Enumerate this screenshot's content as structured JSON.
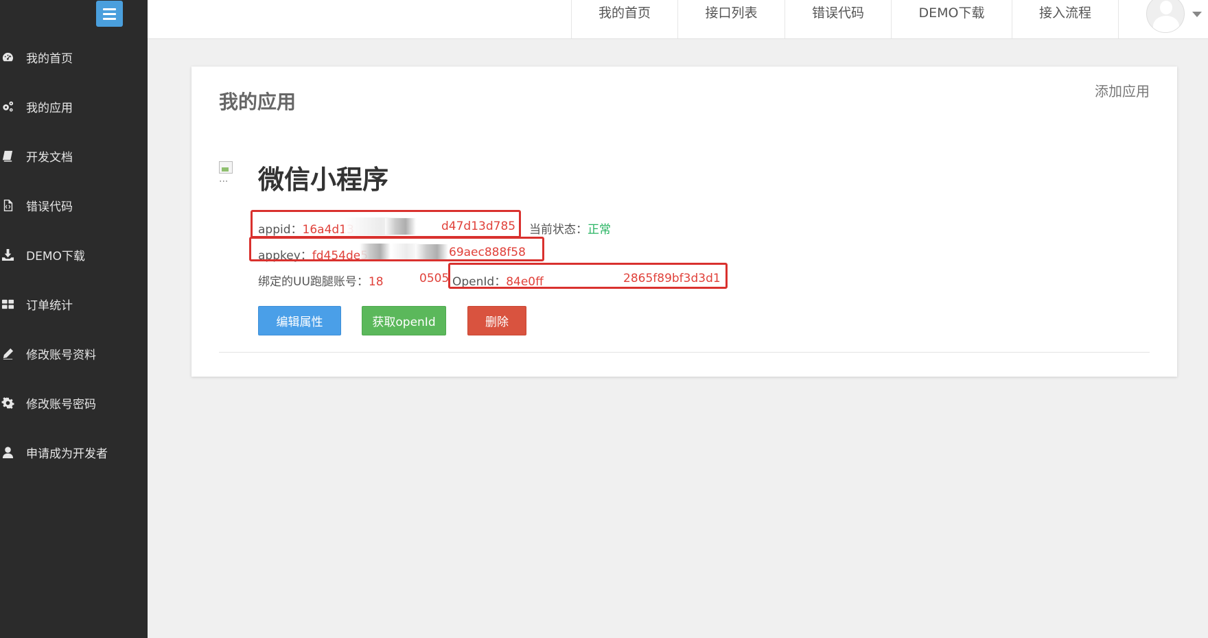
{
  "sidebar": {
    "items": [
      {
        "label": "我的首页",
        "icon": "dashboard-icon"
      },
      {
        "label": "我的应用",
        "icon": "cogs-icon"
      },
      {
        "label": "开发文档",
        "icon": "book-icon"
      },
      {
        "label": "错误代码",
        "icon": "code-file-icon"
      },
      {
        "label": "DEMO下载",
        "icon": "download-icon"
      },
      {
        "label": "订单统计",
        "icon": "grid-icon"
      },
      {
        "label": "修改账号资料",
        "icon": "pencil-icon"
      },
      {
        "label": "修改账号密码",
        "icon": "gear-icon"
      },
      {
        "label": "申请成为开发者",
        "icon": "user-icon"
      }
    ]
  },
  "topnav": {
    "tabs": [
      "我的首页",
      "接口列表",
      "错误代码",
      "DEMO下载",
      "接入流程"
    ]
  },
  "main": {
    "title": "我的应用",
    "add_app": "添加应用",
    "app": {
      "icon_alt": "...",
      "name": "微信小程序",
      "appid_label": "appid：",
      "appid_prefix": "16a4d13",
      "appid_suffix": "d47d13d785",
      "status_label": "当前状态：",
      "status_value": "正常",
      "appkey_label": "appkey：",
      "appkey_prefix": "fd454de5",
      "appkey_suffix": "69aec888f58",
      "uu_label": "绑定的UU跑腿账号：",
      "uu_prefix": "18",
      "uu_suffix": "0505",
      "openid_label": "OpenId：",
      "openid_prefix": "84e0ff",
      "openid_suffix": "2865f89bf3d3d1"
    },
    "buttons": {
      "edit": "编辑属性",
      "get_openid": "获取openId",
      "delete": "删除"
    }
  },
  "colors": {
    "sidebar_bg": "#2b2b2b",
    "accent_blue": "#4a9fe8",
    "value_red": "#e0413a",
    "status_green": "#29b463",
    "highlight_red": "#d9312e"
  }
}
